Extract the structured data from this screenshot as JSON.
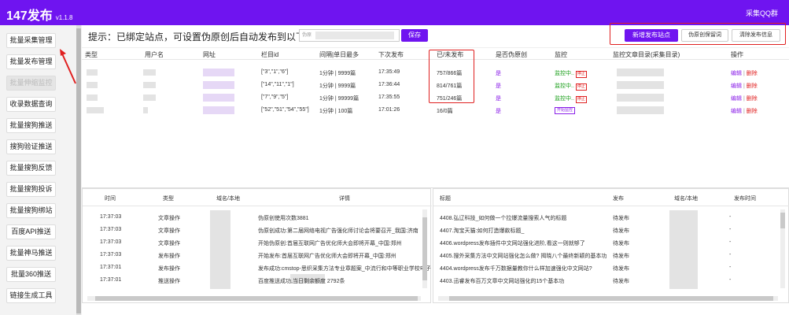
{
  "app": {
    "title": "147发布",
    "version": "v1.1.8",
    "group_link": "采集QQ群"
  },
  "sidebar": {
    "items": [
      {
        "label": "批量采集管理"
      },
      {
        "label": "批量发布管理"
      },
      {
        "label": "批量伸缩监控"
      },
      {
        "label": "收录数据查询"
      },
      {
        "label": "批量搜狗推送"
      },
      {
        "label": "搜狗验证推送"
      },
      {
        "label": "批量搜狗反馈"
      },
      {
        "label": "批量搜狗投诉"
      },
      {
        "label": "批量搜狗绑站"
      },
      {
        "label": "百度API推送"
      },
      {
        "label": "批量神马推送"
      },
      {
        "label": "批量360推送"
      },
      {
        "label": "链接生成工具"
      }
    ]
  },
  "toolbar": {
    "hint": "提示：已绑定站点，可设置伪原创后自动发布到以下站点",
    "input_placeholder": "伪原",
    "save_label": "保存",
    "new_site_label": "新增发布站点",
    "pseudo_label": "伪原创保留词",
    "clear_label": "清除发布信息"
  },
  "table": {
    "headers": [
      "类型",
      "用户名",
      "网址",
      "栏目id",
      "间隔|单日最多",
      "下次发布",
      "已/未发布",
      "是否伪原创",
      "监控",
      "监控文章目录(采集目录)",
      "操作"
    ],
    "rows": [
      {
        "column_id": "[\"3\",\"1\",\"6\"]",
        "interval": "1分钟 | 9999篇",
        "next": "17:35:49",
        "counts": "757/866篇",
        "pseudo": "是",
        "monitor": "监控中..",
        "stop": "停止",
        "edit": "编辑",
        "sep": "|",
        "delete": "删除"
      },
      {
        "column_id": "[\"14\",\"11\",\"1\"]",
        "interval": "1分钟 | 9999篇",
        "next": "17:36:44",
        "counts": "814/761篇",
        "pseudo": "是",
        "monitor": "监控中..",
        "stop": "停止",
        "edit": "编辑",
        "sep": "|",
        "delete": "删除"
      },
      {
        "column_id": "[\"7\",\"9\",\"5\"]",
        "interval": "1分钟 | 99999篇",
        "next": "17:35:55",
        "counts": "751/246篇",
        "pseudo": "是",
        "monitor": "监控中..",
        "stop": "停止",
        "edit": "编辑",
        "sep": "|",
        "delete": "删除"
      },
      {
        "column_id": "[\"52\",\"51\",\"54\",\"55\"]",
        "interval": "1分钟 | 100篇",
        "next": "17:01:26",
        "counts": "16/0篇",
        "pseudo": "是",
        "monitor_btn": "开始监控",
        "edit": "编辑",
        "sep": "|",
        "delete": "删除"
      }
    ]
  },
  "log": {
    "headers": [
      "时间",
      "类型",
      "域名/本地",
      "详情"
    ],
    "rows": [
      {
        "time": "17:37:03",
        "type": "文章操作",
        "detail": "伪原创使用次数3881"
      },
      {
        "time": "17:37:03",
        "type": "文章操作",
        "detail": "伪原创成功:第二届网络电视广告强化师讨论会将要召开_我国:济南"
      },
      {
        "time": "17:37:03",
        "type": "文章操作",
        "detail": "开始伪原创:首届互联网广告优化师大会即将开幕_中国:郑州"
      },
      {
        "time": "17:37:03",
        "type": "发布操作",
        "detail": "开始发布:首届互联网广告优化师大会即将开幕_中国:郑州"
      },
      {
        "time": "17:37:01",
        "type": "发布操作",
        "detail": "发布成功:cmstop-思织采集方法专业章题案_中流行和中等职业学校电子"
      },
      {
        "time": "17:37:01",
        "type": "推送操作",
        "detail": "百度推送成功,当日剩余额度 2792条"
      }
    ]
  },
  "publish": {
    "headers": [
      "标题",
      "发布",
      "域名/本地",
      "发布时间"
    ],
    "rows": [
      {
        "title": "4408.弘辽科技_如何做一个拉爆流量搜索人气的标题",
        "status": "待发布",
        "time": "-"
      },
      {
        "title": "4407.淘宝天猫:如何打造爆款标题_",
        "status": "待发布",
        "time": "-"
      },
      {
        "title": "4406.wordpress发布插件中文网站强化进阶,看这一则就够了",
        "status": "待发布",
        "time": "-"
      },
      {
        "title": "4405.搜外采集方法中文网站强化怎么做? 揭晓八个最终新颖的基本功",
        "status": "待发布",
        "time": "-"
      },
      {
        "title": "4404.wordpress发布千万数据量教你什么样加速强化中文网站?",
        "status": "待发布",
        "time": "-"
      },
      {
        "title": "4403.迅睿发布百万文章中文网站强化的15个基本功",
        "status": "待发布",
        "time": "-"
      }
    ]
  }
}
